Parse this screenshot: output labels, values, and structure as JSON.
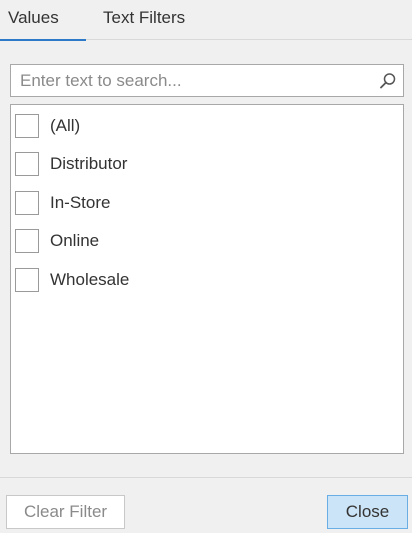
{
  "tabs": [
    {
      "label": "Values",
      "active": true
    },
    {
      "label": "Text Filters",
      "active": false
    }
  ],
  "search": {
    "placeholder": "Enter text to search...",
    "value": "",
    "icon": "search-icon"
  },
  "list": {
    "items": [
      {
        "label": "(All)",
        "checked": false
      },
      {
        "label": "Distributor",
        "checked": false
      },
      {
        "label": "In-Store",
        "checked": false
      },
      {
        "label": "Online",
        "checked": false
      },
      {
        "label": "Wholesale",
        "checked": false
      }
    ]
  },
  "footer": {
    "clear_filter_label": "Clear Filter",
    "clear_filter_enabled": false,
    "close_label": "Close"
  },
  "colors": {
    "accent": "#2b79c7",
    "close_button_bg": "#cce4f7",
    "close_button_border": "#6aaee6",
    "panel_bg": "#f0f0f0"
  }
}
